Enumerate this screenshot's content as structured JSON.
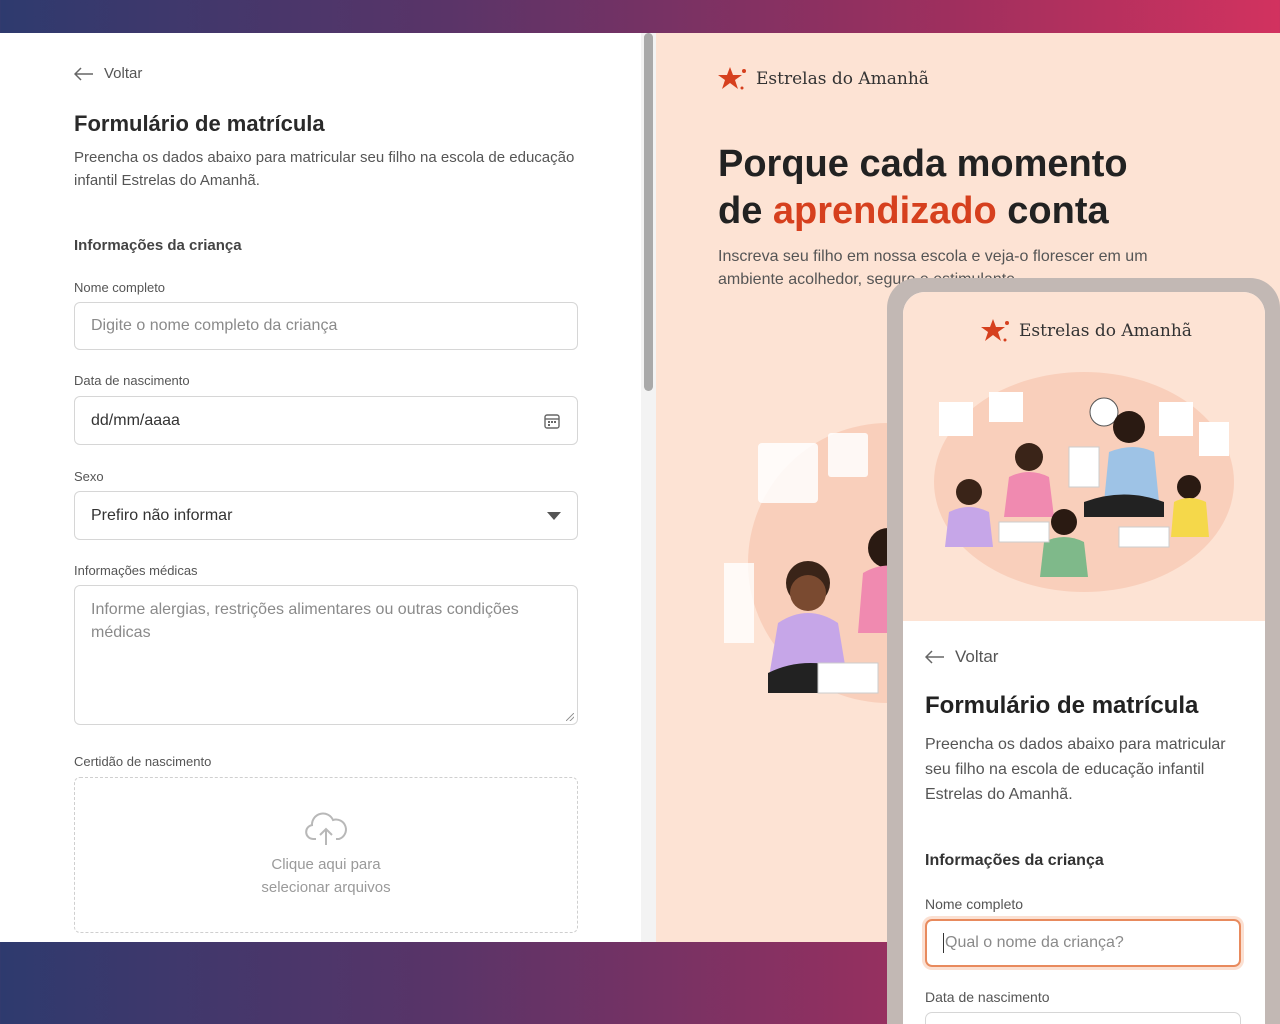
{
  "form": {
    "back_label": "Voltar",
    "title": "Formulário de matrícula",
    "subtitle": "Preencha os dados abaixo para matricular seu filho na escola de educação infantil Estrelas do Amanhã.",
    "section_child": "Informações da criança",
    "fields": {
      "full_name": {
        "label": "Nome completo",
        "placeholder": "Digite o nome completo da criança"
      },
      "birth_date": {
        "label": "Data de nascimento",
        "value": "dd/mm/aaaa"
      },
      "sex": {
        "label": "Sexo",
        "value": "Prefiro não informar"
      },
      "medical": {
        "label": "Informações médicas",
        "placeholder": "Informe alergias, restrições alimentares ou outras condições médicas"
      },
      "certificate": {
        "label": "Certidão de nascimento",
        "upload_line1": "Clique aqui para",
        "upload_line2": "selecionar arquivos"
      }
    }
  },
  "hero": {
    "brand": "Estrelas do Amanhã",
    "heading_line1": "Porque cada momento",
    "heading_pre": "de ",
    "heading_accent": "aprendizado",
    "heading_post": " conta",
    "paragraph": "Inscreva seu filho em nossa escola e veja-o florescer em um ambiente acolhedor, seguro e estimulante."
  },
  "mobile": {
    "brand": "Estrelas do Amanhã",
    "back_label": "Voltar",
    "title": "Formulário de matrícula",
    "subtitle": "Preencha os dados abaixo para matricular seu filho na escola de educação infantil Estrelas do Amanhã.",
    "section_child": "Informações da criança",
    "name_label": "Nome completo",
    "name_placeholder": "Qual o nome da criança?",
    "birth_label": "Data de nascimento"
  },
  "colors": {
    "accent": "#d6401e",
    "hero_bg": "#fde3d4",
    "focus_border": "#e88a5d"
  },
  "icons": [
    "arrow-left-icon",
    "calendar-icon",
    "caret-down-icon",
    "cloud-upload-icon",
    "star-logo-icon"
  ]
}
